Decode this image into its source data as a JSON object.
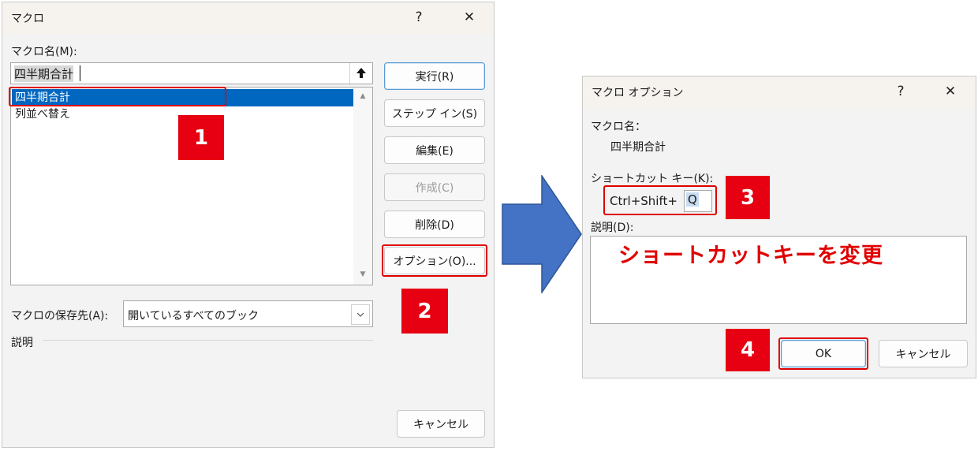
{
  "macro_dialog": {
    "title": "マクロ",
    "help": "?",
    "close": "✕",
    "name_label": "マクロ名(M):",
    "name_value": "四半期合計",
    "macros": [
      "四半期合計",
      "列並べ替え"
    ],
    "buttons": {
      "run": "実行(R)",
      "step_in": "ステップ イン(S)",
      "edit": "編集(E)",
      "create": "作成(C)",
      "delete": "削除(D)",
      "options": "オプション(O)...",
      "cancel": "キャンセル"
    },
    "store_label": "マクロの保存先(A):",
    "store_value": "開いているすべてのブック",
    "description_label": "説明"
  },
  "options_dialog": {
    "title": "マクロ オプション",
    "help": "?",
    "close": "✕",
    "macro_name_label": "マクロ名：",
    "macro_name_value": "四半期合計",
    "shortcut_label": "ショートカット キー(K):",
    "shortcut_prefix": "Ctrl+Shift+",
    "shortcut_key": "Q",
    "description_label": "説明(D):",
    "annotation": "ショートカットキーを変更",
    "ok": "OK",
    "cancel": "キャンセル"
  },
  "steps": [
    "1",
    "2",
    "3",
    "4"
  ],
  "colors": {
    "accent": "#0067c0",
    "highlight": "#e60012",
    "arrow": "#4472c4"
  },
  "icons": {
    "up": "upload-arrow-icon",
    "scroll_up": "scroll-up-icon",
    "scroll_down": "scroll-down-icon",
    "dropdown": "chevron-down-icon",
    "flow": "right-arrow-icon"
  }
}
